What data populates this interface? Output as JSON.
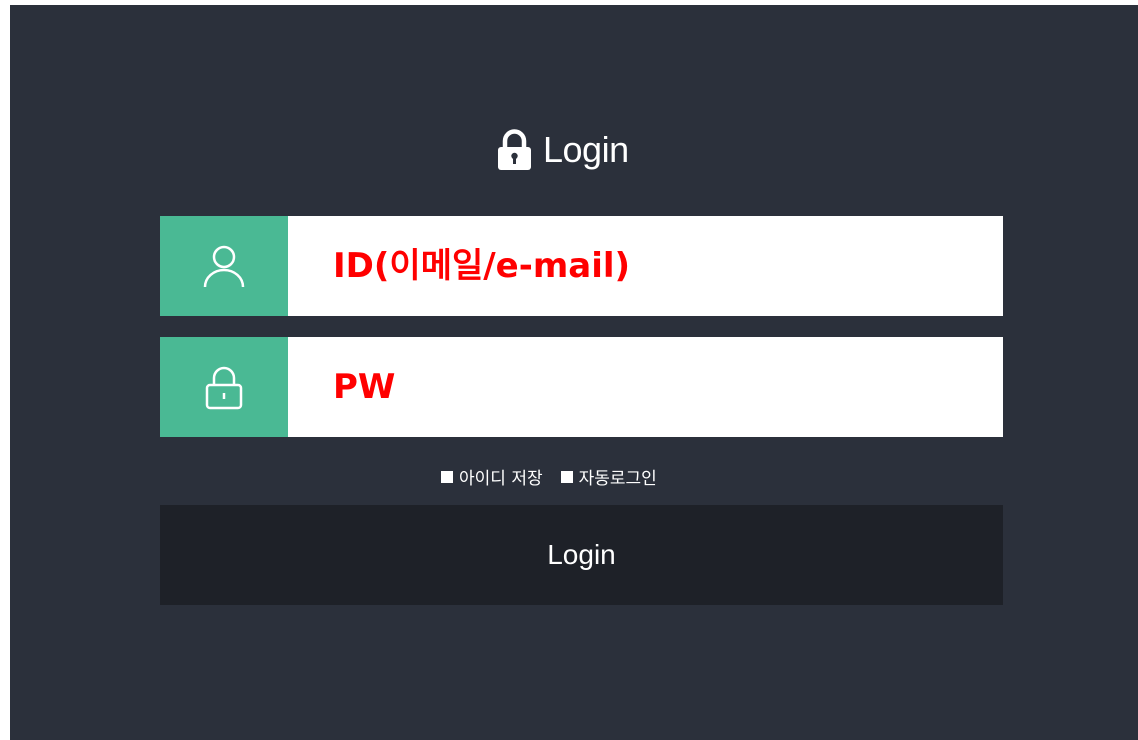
{
  "header": {
    "title": "Login",
    "icon": "lock-icon"
  },
  "form": {
    "id_field": {
      "placeholder": "ID(이메일/e-mail)",
      "icon": "user-icon"
    },
    "pw_field": {
      "placeholder": "PW",
      "icon": "lock-icon"
    },
    "options": {
      "save_id_label": "아이디 저장",
      "auto_login_label": "자동로그인"
    },
    "submit_label": "Login"
  },
  "colors": {
    "background": "#2b303b",
    "accent": "#4ab994",
    "button": "#1e2128",
    "placeholder_text": "#ff0000"
  }
}
